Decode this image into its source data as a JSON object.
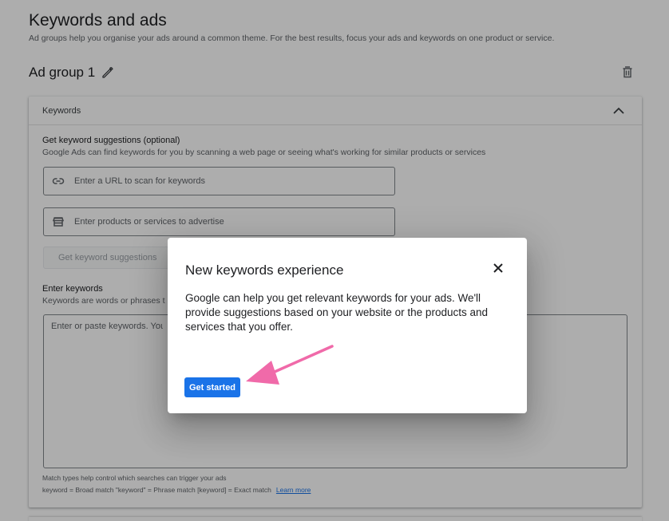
{
  "page": {
    "title": "Keywords and ads",
    "subtitle": "Ad groups help you organise your ads around a common theme. For the best results, focus your ads and keywords on one product or service."
  },
  "ad_group": {
    "title": "Ad group 1",
    "edit_icon": "pencil-icon",
    "delete_icon": "trash-icon"
  },
  "keywords_card": {
    "header": "Keywords",
    "collapse_icon": "chevron-up-icon",
    "suggestions": {
      "heading": "Get keyword suggestions (optional)",
      "description": "Google Ads can find keywords for you by scanning a web page or seeing what's working for similar products or services",
      "url_placeholder": "Enter a URL to scan for keywords",
      "url_icon": "link-icon",
      "products_placeholder": "Enter products or services to advertise",
      "products_icon": "store-icon",
      "button_label": "Get keyword suggestions"
    },
    "enter": {
      "heading": "Enter keywords",
      "description": "Keywords are words or phrases t",
      "textarea_placeholder": "Enter or paste keywords. You c"
    },
    "match_help": "Match types help control which searches can trigger your ads",
    "match_legend": "keyword = Broad match  \"keyword\" = Phrase match  [keyword] = Exact match",
    "learn_more": "Learn more"
  },
  "dialog": {
    "title": "New keywords experience",
    "body": "Google can help you get relevant keywords for your ads. We'll provide suggestions based on your website or the products and services that you offer.",
    "button_label": "Get started",
    "close_icon": "close-icon"
  },
  "colors": {
    "accent": "#1a73e8",
    "annotation_arrow": "#f06aa9",
    "scrim": "rgba(0,0,0,0.32)"
  }
}
